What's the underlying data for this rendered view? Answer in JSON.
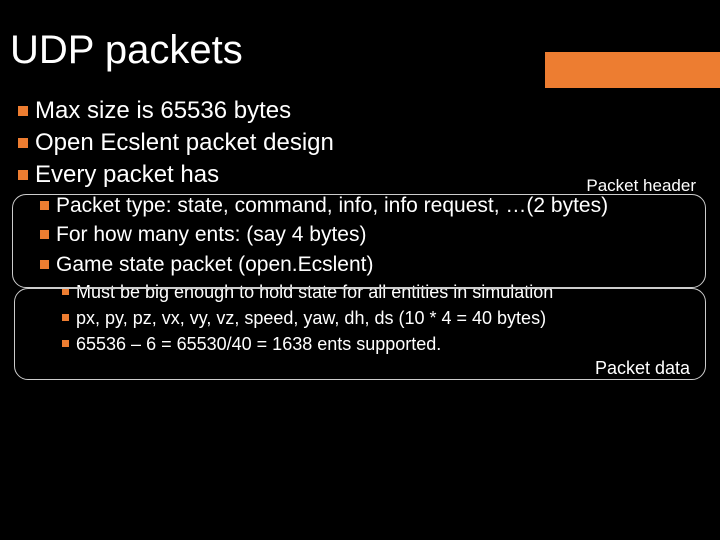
{
  "title": "UDP packets",
  "labels": {
    "header": "Packet header",
    "data": "Packet data"
  },
  "bullets": {
    "l1": [
      "Max size is 65536 bytes",
      "Open Ecslent packet design",
      "Every packet has"
    ],
    "l2": [
      "Packet type: state, command, info, info request, …(2 bytes)",
      "For how many ents: (say 4 bytes)",
      "Game state packet (open.Ecslent)"
    ],
    "l3": [
      "Must be big enough to hold state for all entities in simulation",
      "px, py, pz, vx, vy, vz, speed, yaw, dh, ds (10 * 4 = 40 bytes)",
      "65536 – 6 = 65530/40 = 1638 ents supported."
    ]
  }
}
